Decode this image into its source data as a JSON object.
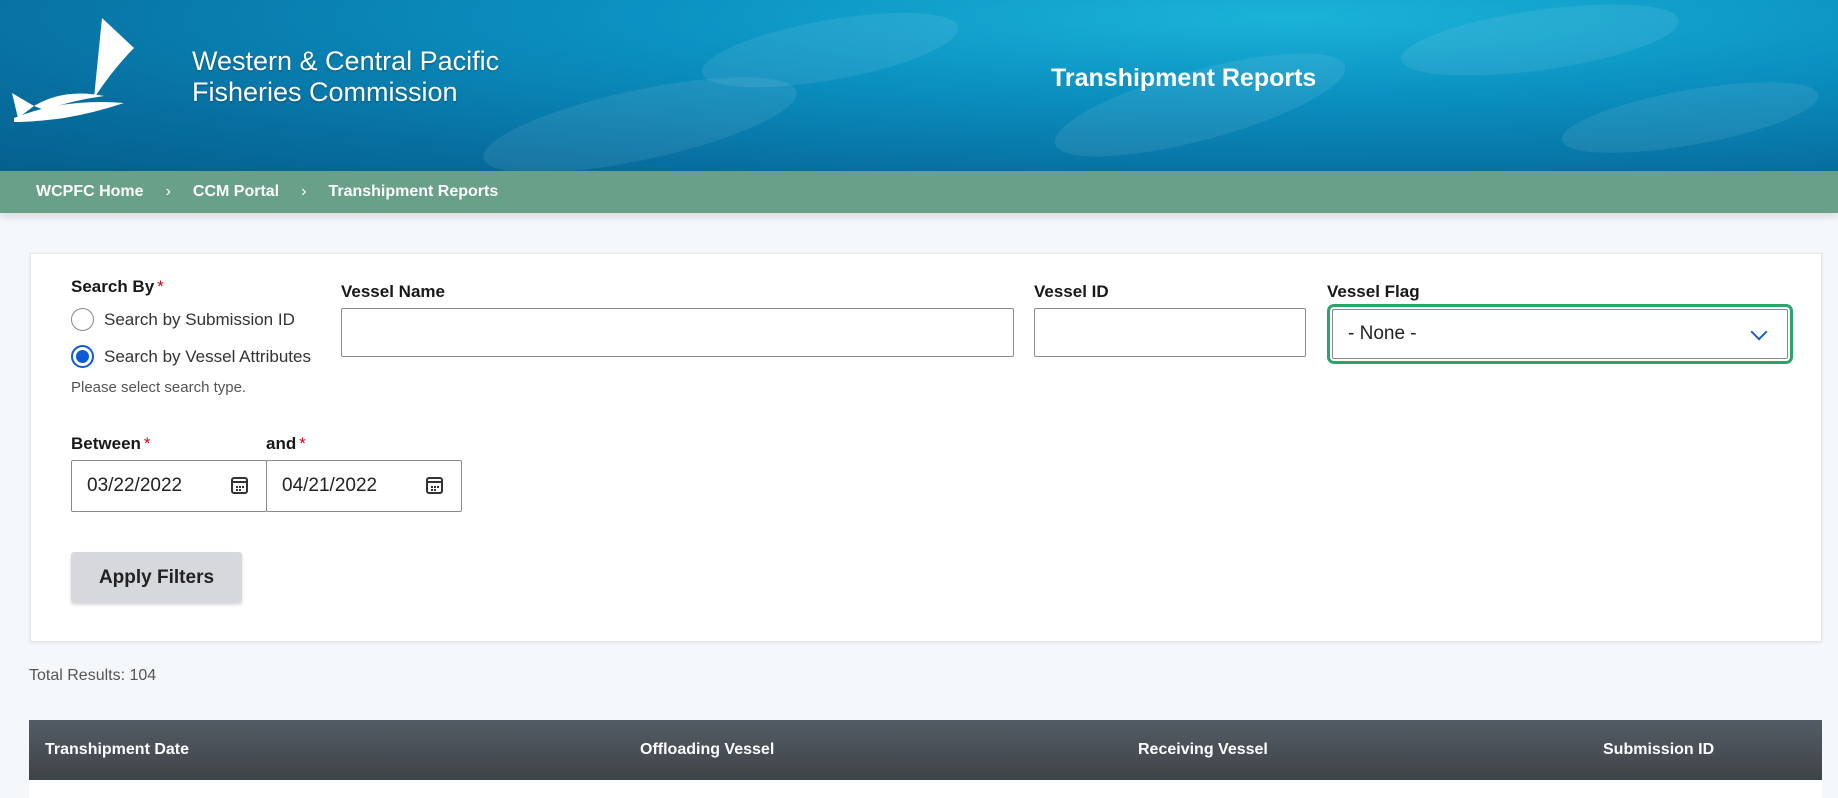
{
  "header": {
    "org_line1": "Western & Central Pacific",
    "org_line2": "Fisheries Commission",
    "title": "Transhipment Reports"
  },
  "breadcrumb": [
    "WCPFC Home",
    "CCM Portal",
    "Transhipment Reports"
  ],
  "breadcrumb_separator": "›",
  "form": {
    "search_by_label": "Search By",
    "required_mark": "*",
    "radio_options": [
      {
        "label": "Search by Submission ID",
        "selected": false
      },
      {
        "label": "Search by Vessel Attributes",
        "selected": true
      }
    ],
    "help_text": "Please select search type.",
    "vessel_name_label": "Vessel Name",
    "vessel_name_value": "",
    "vessel_id_label": "Vessel ID",
    "vessel_id_value": "",
    "vessel_flag_label": "Vessel Flag",
    "vessel_flag_value": "- None -",
    "between_label": "Between",
    "and_label": "and",
    "date_from": "03/22/2022",
    "date_to": "04/21/2022",
    "apply_label": "Apply Filters"
  },
  "results": {
    "total_text": "Total Results: 104"
  },
  "table": {
    "columns": [
      "Transhipment Date",
      "Offloading Vessel",
      "Receiving Vessel",
      "Submission ID"
    ]
  },
  "colors": {
    "breadcrumb_bg": "#68a088",
    "focus": "#2aa56a",
    "radio": "#0b5cd5",
    "table_header": "#474c52"
  }
}
